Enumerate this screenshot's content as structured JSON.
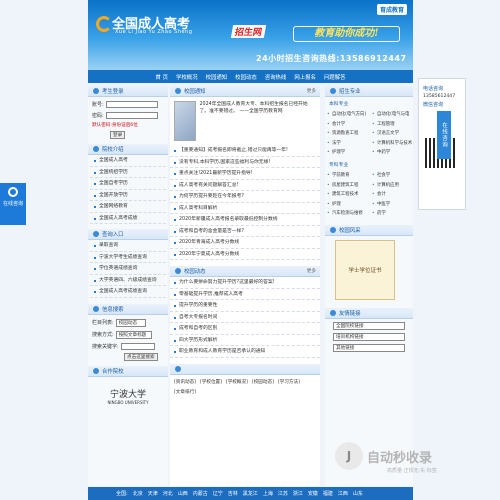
{
  "banner": {
    "title": "全国成人高考",
    "subtitle": "Xue Li Jiao Yu Zhao Sheng",
    "badge": "招生网",
    "slogan": "教育助你成功!",
    "hotline": "24小时招生咨询热线:13586912447",
    "brand": "育成教育"
  },
  "nav": [
    "首 页",
    "学校概况",
    "校园通知",
    "校园动态",
    "咨询热线",
    "网上报名",
    "问题解答"
  ],
  "login": {
    "title": "考生登录",
    "account_label": "账号:",
    "password_label": "密码:",
    "hint": "默认密码:身份证后6位",
    "button": "登录"
  },
  "schools": {
    "title": "院校介绍",
    "items": [
      "全国成人高考",
      "全国统招学历",
      "全国自考学历",
      "全国开放学历",
      "全国网络教育",
      "全国成人高考成绩"
    ]
  },
  "query": {
    "title": "查询入口",
    "items": [
      "录取查询",
      "宁波大学考生成绩查询",
      "学位英语成绩查询",
      "大学英语四、六级成绩查询",
      "全国成人高考成绩查询"
    ]
  },
  "search": {
    "title": "信息搜索",
    "column_label": "栏目列表:",
    "column_value": "校园动态",
    "type_label": "搜索方式:",
    "type_value": "按照文章标题",
    "keyword_label": "搜索关键字:",
    "button": "点击这里搜索"
  },
  "partner": {
    "title": "合作院校",
    "school_cn": "宁波大学",
    "school_en": "NINGBO UNIVERSITY"
  },
  "notice": {
    "title": "校园通知",
    "more": "更多",
    "lead": "2024年全国成人教育大专、本科招生报名已经开始了。准不要错过。 ——全国学历教育网",
    "items": [
      "【重要通知】成考报名即将截止,错过只能再等一年!",
      "没有专科,本科学历,国家这些福利与你无缘!",
      "重点关注!2021最新学历提升指导!",
      "成人高考有关问题解答汇总!",
      "为何学历提升要趁在今年报考?",
      "成人高考科目解析",
      "2020年新疆成人高考报名录取最低控制分数线",
      "成考和自考的含金量是否一样?",
      "2020年青海成人高考分数线",
      "2020年宁夏成人高考分数线"
    ]
  },
  "news": {
    "title": "校园动态",
    "more": "更多",
    "items": [
      "为什么要拼命努力提升学历?这里最好的答案!",
      "零基础提升学历,推荐成人高考",
      "提升学历的重要性",
      "自考大专报名时间",
      "成考和自考的区别",
      "四大学历形式解析",
      "职业教育和成人教育学历是否承认的通知"
    ]
  },
  "bottom_links": [
    "[资讯动态]",
    "[学校位置]",
    "[学校概况]",
    "[校园动态]",
    "[学习方法]",
    "[文章排行]"
  ],
  "majors": {
    "title": "招生专业",
    "undergrad_title": "本科专业",
    "undergrad": [
      "自动化(电气方向)",
      "自动化(电气与电",
      "会计学",
      "工程管理",
      "资源勘查工程",
      "汉语言文学",
      "法学",
      "计算机科学与技术",
      "护理学",
      "中药学"
    ],
    "college_title": "专科专业",
    "college": [
      "学前教育",
      "社会学",
      "房屋建筑工程",
      "计算机应用",
      "建筑工程技术",
      "会计",
      "护理",
      "中医学",
      "汽车检测与维修",
      "药学"
    ]
  },
  "gallery": {
    "title": "校园风采",
    "caption": "学士学位证书"
  },
  "links": {
    "title": "友情链接",
    "select1": "全国院校链接",
    "select2": "培训机构链接",
    "select3": "其他链接"
  },
  "side_tab": "在线咨询",
  "float": {
    "phone_title": "电话咨询",
    "phone": "13585612447",
    "wechat_title": "微信咨询",
    "consult": "在线咨询"
  },
  "bottom_nav": [
    "全国:",
    "北京",
    "天津",
    "河北",
    "山西",
    "内蒙古",
    "辽宁",
    "吉林",
    "黑龙江",
    "上海",
    "江苏",
    "浙江",
    "安徽",
    "福建",
    "江西",
    "山东"
  ],
  "watermark": {
    "title": "自动秒收录",
    "sub": "高质量·正规无·东·标签"
  }
}
